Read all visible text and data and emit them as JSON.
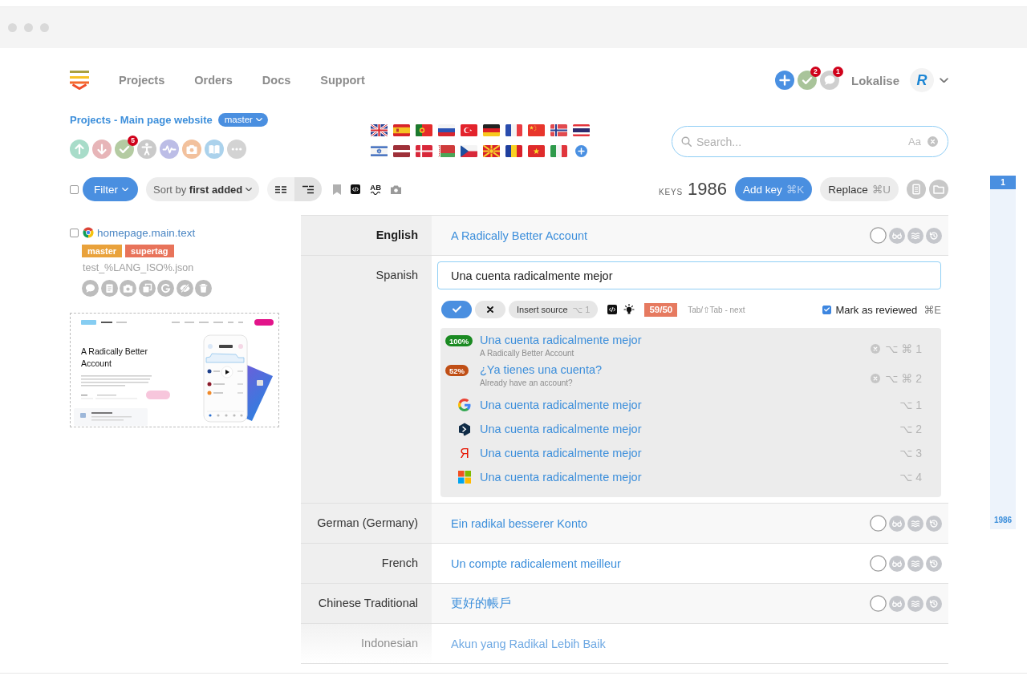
{
  "header": {
    "nav": [
      {
        "label": "Projects",
        "selected": false
      },
      {
        "label": "Orders",
        "selected": false
      },
      {
        "label": "Docs",
        "selected": false
      },
      {
        "label": "Support",
        "selected": false
      }
    ],
    "tasks_badge": "2",
    "messages_badge": "1",
    "team": "Lokalise",
    "avatar_letter": "R"
  },
  "project": {
    "title": "Projects - Main page website",
    "branch": "master",
    "tasks_badge": "5"
  },
  "search": {
    "placeholder": "Search...",
    "case_toggle": "Aa"
  },
  "toolbar": {
    "select_all": {
      "checked": false
    },
    "filter": "Filter",
    "sort": "Sort by **first added**",
    "views": [
      {
        "selected": false
      },
      {
        "selected": true
      }
    ],
    "spellcheck": "AB",
    "keys_label": "KEYS",
    "keys_count": "1986",
    "add_key": "Add key",
    "add_key_shortcut": "⌘K",
    "replace": "Replace",
    "replace_shortcut": "⌘U"
  },
  "key": {
    "checked": false,
    "name": "homepage.main.text",
    "tags": [
      {
        "label": "master",
        "color": "#e9a23b"
      },
      {
        "label": "supertag",
        "color": "#e8735a"
      }
    ],
    "file": "test_%LANG_ISO%.json",
    "screenshot": {
      "heading": "A Radically Better Account"
    }
  },
  "translations": [
    {
      "kind": "text",
      "language": "English",
      "value": "A Radically Better Account",
      "base": true,
      "faded": false
    },
    {
      "kind": "editor",
      "language": "Spanish",
      "value": "Una cuenta radicalmente mejor",
      "base": false,
      "faded": false,
      "editor": {
        "insert_source": "Insert source",
        "insert_shortcut": "⌥ 1",
        "char_count": "59/50",
        "over_limit": true,
        "hint": "Tab/⇧Tab - next",
        "mark_reviewed": {
          "label": "Mark as reviewed",
          "checked": true,
          "shortcut": "⌘E"
        },
        "suggestions": [
          {
            "kind": "tm",
            "match": "100%",
            "color": "#1a8a22",
            "text": "Una cuenta radicalmente mejor",
            "source": "A Radically Better Account",
            "shortcut": "⌥ ⌘ 1"
          },
          {
            "kind": "tm",
            "match": "52%",
            "color": "#c04f16",
            "text": "¿Ya tienes una cuenta?",
            "source": "Already have an account?",
            "shortcut": "⌥ ⌘ 2"
          },
          {
            "kind": "gmark",
            "text": "Una cuenta radicalmente mejor",
            "shortcut": "⌥ 1"
          },
          {
            "kind": "hexmark",
            "text": "Una cuenta radicalmente mejor",
            "shortcut": "⌥ 2"
          },
          {
            "kind": "letter",
            "glyph": "Я",
            "text": "Una cuenta radicalmente mejor",
            "shortcut": "⌥ 3"
          },
          {
            "kind": "squares",
            "text": "Una cuenta radicalmente mejor",
            "shortcut": "⌥ 4"
          }
        ]
      }
    },
    {
      "kind": "text",
      "language": "German (Germany)",
      "value": "Ein radikal besserer Konto",
      "base": false,
      "faded": false
    },
    {
      "kind": "text",
      "language": "French",
      "value": "Un compte radicalement meilleur",
      "base": false,
      "faded": false
    },
    {
      "kind": "text",
      "language": "Chinese Traditional",
      "value": "更好的帳戶",
      "base": false,
      "faded": false
    },
    {
      "kind": "text",
      "language": "Indonesian",
      "value": "Akun yang Radikal Lebih Baik",
      "base": false,
      "faded": true
    }
  ],
  "key_range": {
    "start": "1",
    "end": "1986"
  }
}
